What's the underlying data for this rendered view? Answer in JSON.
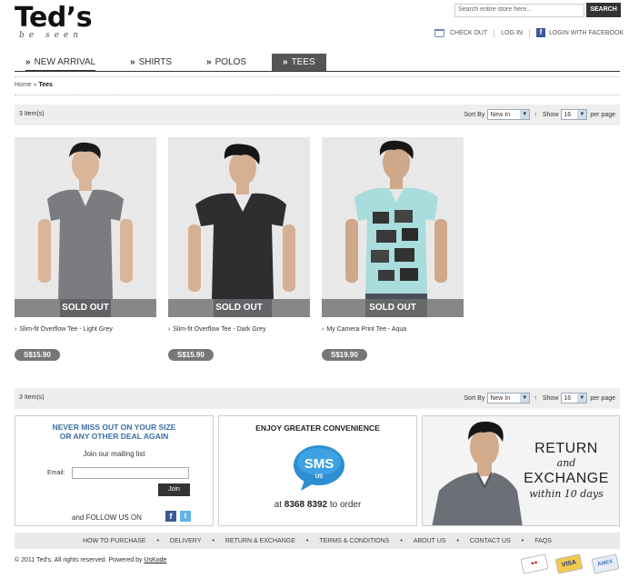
{
  "header": {
    "logo": "Ted’s",
    "tagline": "be seen",
    "search_placeholder": "Search entire store here...",
    "search_button": "SEARCH",
    "links": {
      "checkout": "CHECK OUT",
      "login": "LOG IN",
      "facebook": "LOGIN WITH FACEBOOK"
    }
  },
  "nav": {
    "items": [
      {
        "label": "NEW ARRIVAL"
      },
      {
        "label": "SHIRTS"
      },
      {
        "label": "POLOS"
      },
      {
        "label": "TEES"
      }
    ]
  },
  "breadcrumb": {
    "home": "Home",
    "sep": "»",
    "current": "Tees"
  },
  "toolbar": {
    "count": "3 Item(s)",
    "sort_label": "Sort By",
    "sort_value": "New In",
    "sort_dir": "↑",
    "show_label": "Show",
    "show_value": "16",
    "per_page": "per page"
  },
  "products": [
    {
      "name": "Slim-fit Overflow Tee - Light Grey",
      "price": "S$15.90",
      "badge": "SOLD OUT",
      "shirt_color": "#7a7c80"
    },
    {
      "name": "Slim-fit Overflow Tee - Dark Grey",
      "price": "S$15.90",
      "badge": "SOLD OUT",
      "shirt_color": "#2e2e30"
    },
    {
      "name": "My Camera Print Tee - Aqua",
      "price": "S$19.90",
      "badge": "SOLD OUT",
      "shirt_color": "#a9dcdc"
    }
  ],
  "newsletter": {
    "title_line1": "NEVER MISS OUT ON YOUR SIZE",
    "title_line2": "OR ANY OTHER DEAL AGAIN",
    "subtitle": "Join our mailing list",
    "email_label": "Email:",
    "join_button": "Join",
    "follow": "and FOLLOW US ON"
  },
  "sms": {
    "title": "ENJOY GREATER CONVENIENCE",
    "bubble_main": "SMS",
    "bubble_sub": "US",
    "at": "at",
    "number": "8368 8392",
    "suffix": "to order"
  },
  "returns": {
    "line1": "RETURN",
    "line2": "and",
    "line3": "EXCHANGE",
    "line4": "within 10 days"
  },
  "footer": {
    "links": [
      "HOW TO PURCHASE",
      "DELIVERY",
      "RETURN & EXCHANGE",
      "TERMS & CONDITIONS",
      "ABOUT US",
      "CONTACT US",
      "FAQS"
    ],
    "copyright": "© 2011 Ted's. All rights reserved. Powered by",
    "powered": "UsKode"
  },
  "payment_cards": [
    "mastercard",
    "VISA",
    "AMEX"
  ],
  "colors": {
    "accent_blue": "#3a6fa3",
    "nav_active": "#555555",
    "price_badge": "#777777"
  }
}
